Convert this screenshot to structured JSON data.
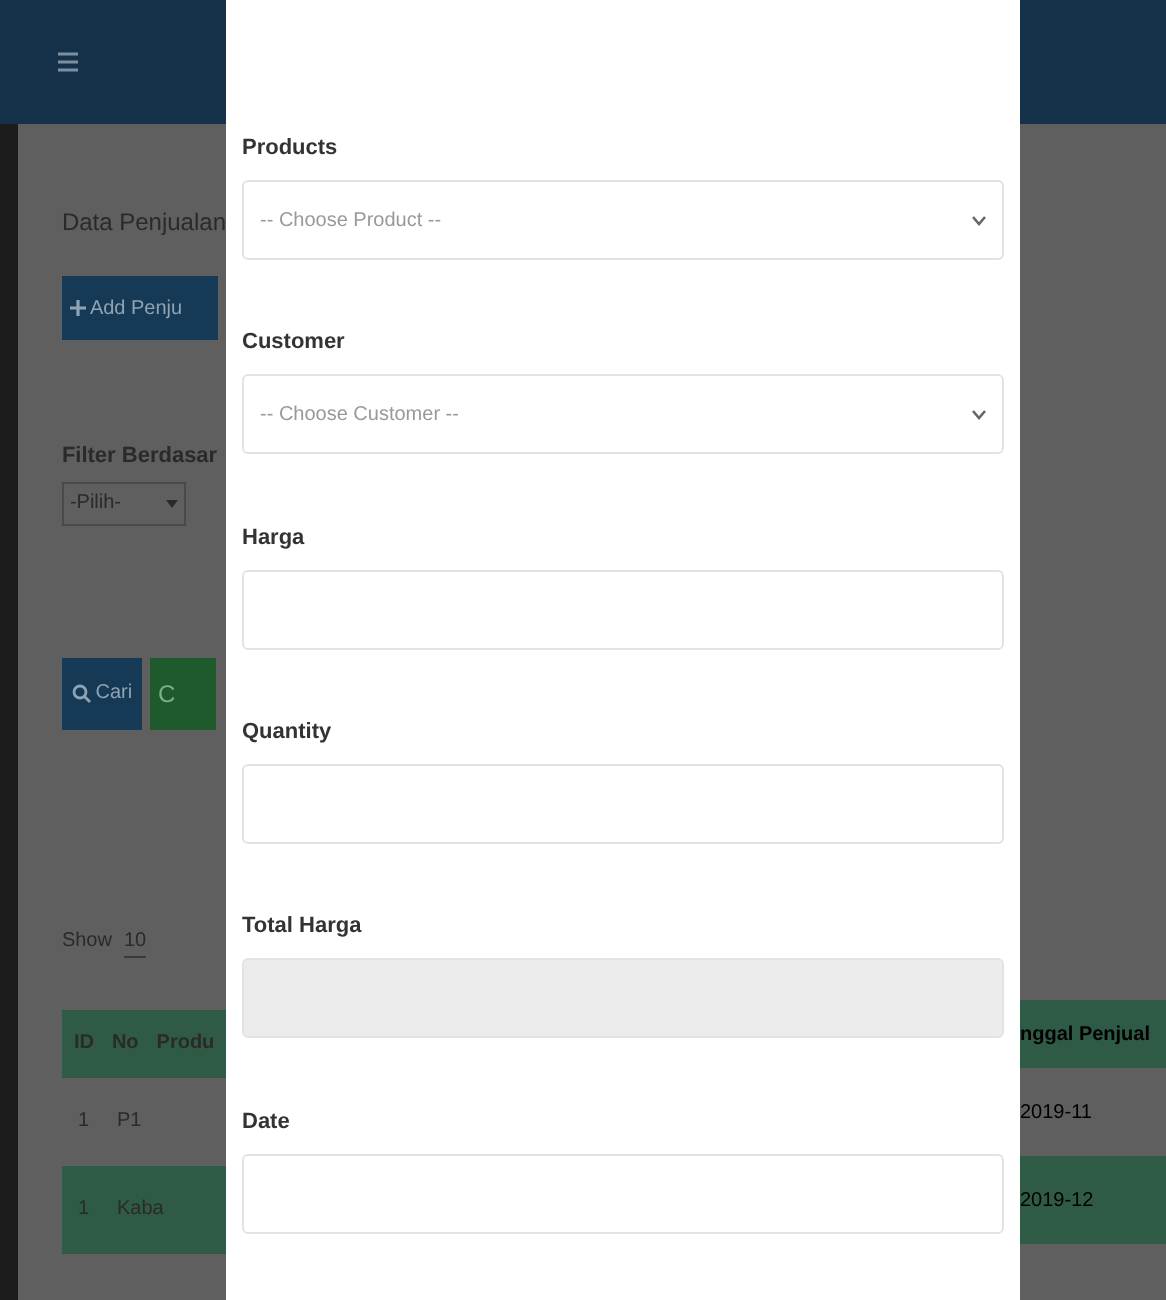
{
  "page": {
    "title": "Data Penjualan",
    "add_button": "Add Penju",
    "filter_label": "Filter Berdasar",
    "filter_select": "-Pilih-",
    "search_button": "Cari",
    "clear_button": "C",
    "show_label": "Show",
    "show_value": "10",
    "table": {
      "columns": [
        "ID",
        "No",
        "Produ"
      ],
      "rows": [
        [
          "1",
          "P1"
        ],
        [
          "1",
          "Kaba"
        ]
      ]
    },
    "table_right": {
      "column": "nggal Penjual",
      "rows": [
        "2019-11",
        "2019-12"
      ]
    }
  },
  "modal": {
    "fields": [
      {
        "kind": "select",
        "label": "Products",
        "placeholder": "-- Choose Product --"
      },
      {
        "kind": "select",
        "label": "Customer",
        "placeholder": "-- Choose Customer --"
      },
      {
        "kind": "input",
        "label": "Harga"
      },
      {
        "kind": "input",
        "label": "Quantity"
      },
      {
        "kind": "disabled",
        "label": "Total Harga"
      },
      {
        "kind": "input",
        "label": "Date"
      }
    ]
  }
}
